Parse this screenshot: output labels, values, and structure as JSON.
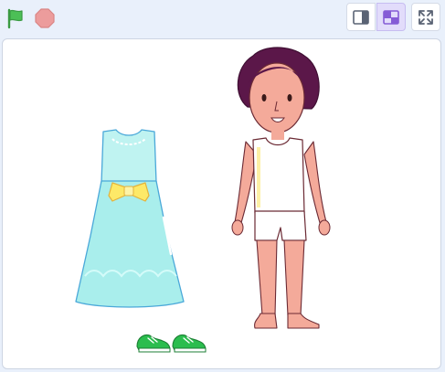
{
  "colors": {
    "flag": "#4cbf56",
    "stop": "#ec9c9c",
    "stage_border": "#cdd5e3",
    "selected_view": "#e2dcfb",
    "dress": "#a9eeec",
    "bow": "#fde968",
    "hair": "#5b1749",
    "skin": "#f4aa9a",
    "shoe": "#2bbd4e"
  },
  "toolbar": {
    "green_flag": {
      "icon": "green-flag-icon"
    },
    "stop": {
      "icon": "stop-sign-icon"
    },
    "small_stage": {
      "icon": "small-stage-icon",
      "selected": false
    },
    "normal_stage": {
      "icon": "normal-stage-icon",
      "selected": true
    },
    "fullscreen": {
      "icon": "fullscreen-icon"
    }
  },
  "stage": {
    "sprites": [
      {
        "name": "dress",
        "icon": "dress-sprite"
      },
      {
        "name": "girl",
        "icon": "girl-sprite"
      },
      {
        "name": "shoes",
        "icon": "sneakers-sprite"
      }
    ]
  }
}
